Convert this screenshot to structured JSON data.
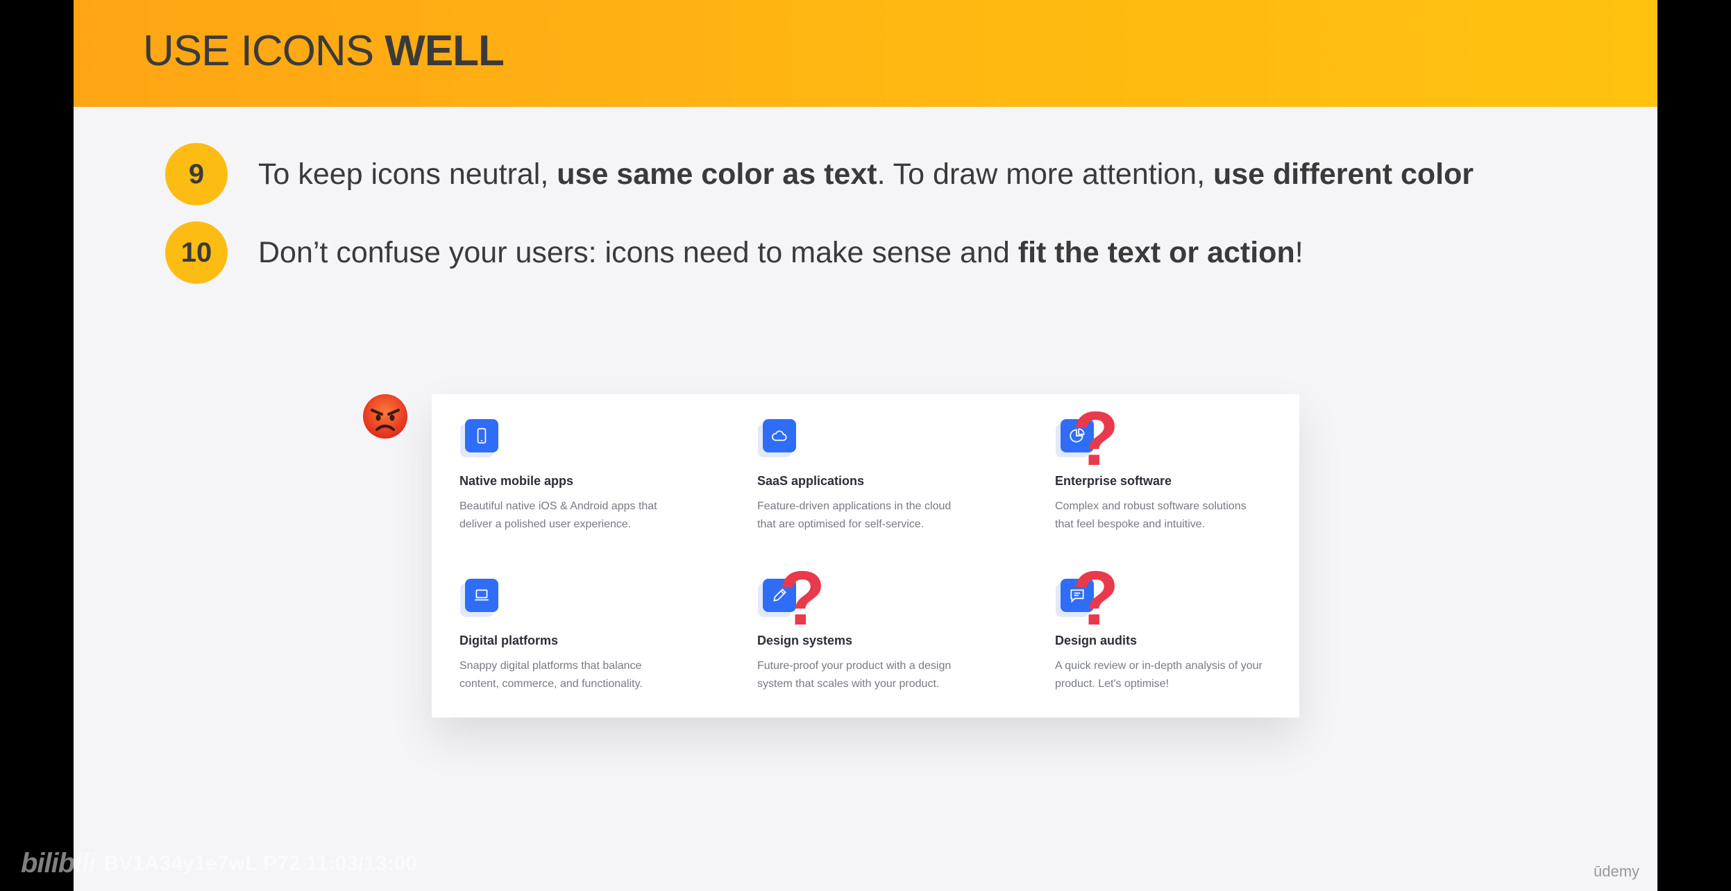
{
  "header": {
    "title_light": "USE ICONS ",
    "title_bold": "WELL"
  },
  "rules": [
    {
      "number": "9",
      "t1": "To keep icons neutral, ",
      "b1": "use same color as text",
      "t2": ". To draw more attention, ",
      "b2": "use different color",
      "t3": ""
    },
    {
      "number": "10",
      "t1": "Don’t confuse your users: icons need to make sense and ",
      "b1": "fit the text or action",
      "t2": "!",
      "b2": "",
      "t3": ""
    }
  ],
  "services": [
    {
      "icon": "smartphone-icon",
      "title": "Native mobile apps",
      "line1": "Beautiful native iOS & Android apps that",
      "line2": "deliver a polished user experience."
    },
    {
      "icon": "cloud-icon",
      "title": "SaaS applications",
      "line1": "Feature-driven applications in the cloud",
      "line2": "that are optimised for self-service."
    },
    {
      "icon": "pie-chart-icon",
      "title": "Enterprise software",
      "line1": "Complex and robust software solutions",
      "line2": "that feel bespoke and intuitive."
    },
    {
      "icon": "laptop-icon",
      "title": "Digital platforms",
      "line1": "Snappy digital platforms that balance",
      "line2": "content, commerce, and functionality."
    },
    {
      "icon": "pen-icon",
      "title": "Design systems",
      "line1": "Future-proof your product with a design",
      "line2": "system that scales with your product."
    },
    {
      "icon": "message-icon",
      "title": "Design audits",
      "line1": "A quick review or in-depth analysis of your",
      "line2": "product. Let's optimise!"
    }
  ],
  "markers": {
    "question": "?"
  },
  "overlay": {
    "watermark_logo": "bilibili",
    "watermark_text": "BV1A34y1e7wL P72 11:03/13:00",
    "brand": "ūdemy"
  },
  "colors": {
    "header": "#ffb811",
    "accent_blue": "#2f6df6",
    "question_red": "#e83a4c",
    "badge": "#fdbc14"
  }
}
